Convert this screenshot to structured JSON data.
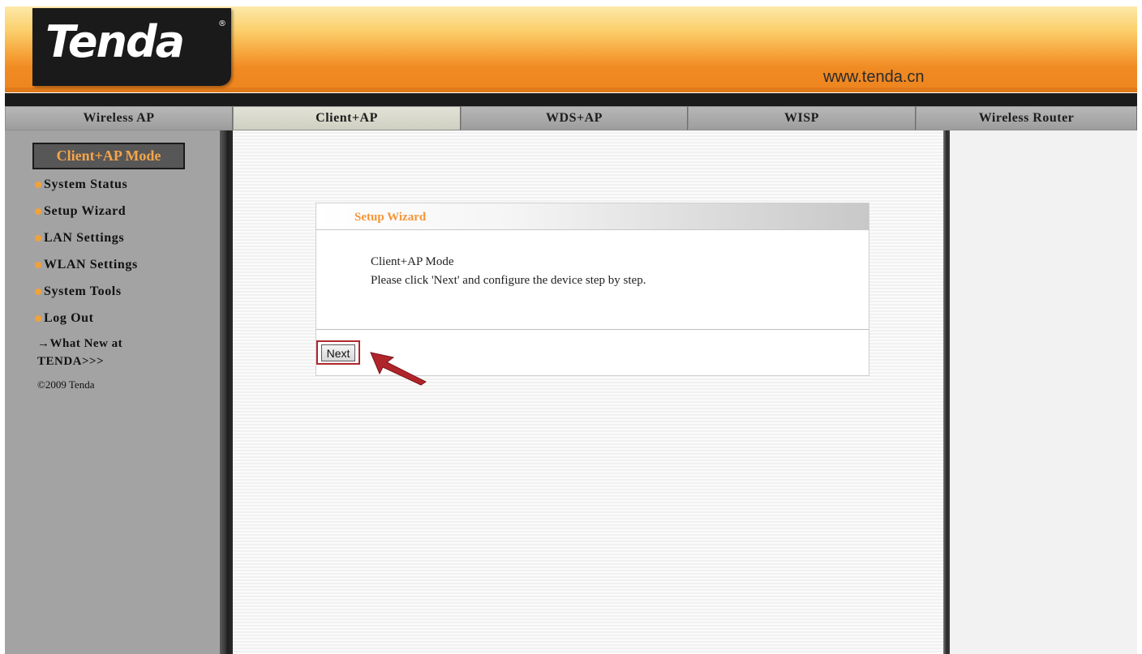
{
  "header": {
    "logo_text": "Tenda",
    "logo_reg": "®",
    "site_url": "www.tenda.cn"
  },
  "tabs": [
    {
      "label": "Wireless AP",
      "active": false
    },
    {
      "label": "Client+AP",
      "active": true
    },
    {
      "label": "WDS+AP",
      "active": false
    },
    {
      "label": "WISP",
      "active": false
    },
    {
      "label": "Wireless Router",
      "active": false
    }
  ],
  "sidebar": {
    "mode_title": "Client+AP Mode",
    "items": [
      {
        "label": "System Status"
      },
      {
        "label": "Setup Wizard"
      },
      {
        "label": "LAN Settings"
      },
      {
        "label": "WLAN Settings"
      },
      {
        "label": "System Tools"
      },
      {
        "label": "Log Out"
      }
    ],
    "whats_new_line1": "→What New at",
    "whats_new_line2": "TENDA>>>",
    "copyright": "©2009 Tenda"
  },
  "wizard": {
    "title": "Setup Wizard",
    "line1": "Client+AP Mode",
    "line2": "Please click 'Next' and configure the device step by step.",
    "next_label": "Next"
  },
  "colors": {
    "accent_orange": "#f5963a",
    "highlight_red": "#b0272c"
  }
}
